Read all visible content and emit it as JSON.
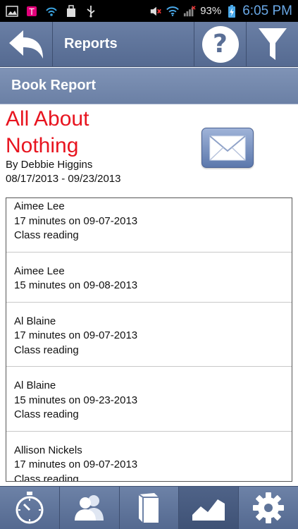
{
  "status_bar": {
    "battery": "93%",
    "time": "6:05 PM",
    "icons": [
      "image-icon",
      "tmobile-icon",
      "wifi-sync-icon",
      "bag-icon",
      "usb-icon",
      "mute-icon",
      "wifi-icon",
      "signal-icon",
      "battery-charging-icon"
    ]
  },
  "header": {
    "back_icon": "back-arrow-icon",
    "title": "Reports",
    "help_label": "?",
    "filter_icon": "filter-icon"
  },
  "section": {
    "title": "Book Report"
  },
  "book": {
    "title_line1": "All About",
    "title_line2": "Nothing",
    "author": "By Debbie Higgins",
    "dates": "08/17/2013 - 09/23/2013",
    "email_icon": "envelope-icon"
  },
  "entries": [
    {
      "name": "Aimee Lee",
      "detail": "17 minutes on 09-07-2013",
      "note": "Class reading"
    },
    {
      "name": "Aimee Lee",
      "detail": "15 minutes on 09-08-2013",
      "note": ""
    },
    {
      "name": "Al Blaine",
      "detail": "17 minutes on 09-07-2013",
      "note": "Class reading"
    },
    {
      "name": "Al Blaine",
      "detail": "15 minutes on 09-23-2013",
      "note": "Class reading"
    },
    {
      "name": "Allison Nickels",
      "detail": "17 minutes on 09-07-2013",
      "note": "Class reading"
    }
  ],
  "tabs": [
    {
      "icon": "stopwatch-icon",
      "active": false
    },
    {
      "icon": "students-icon",
      "active": false
    },
    {
      "icon": "book-icon",
      "active": false
    },
    {
      "icon": "chart-icon",
      "active": true
    },
    {
      "icon": "gear-icon",
      "active": false
    }
  ],
  "colors": {
    "header": "#5a6f96",
    "title_red": "#e8141f",
    "status_blue": "#6aa8e6"
  }
}
